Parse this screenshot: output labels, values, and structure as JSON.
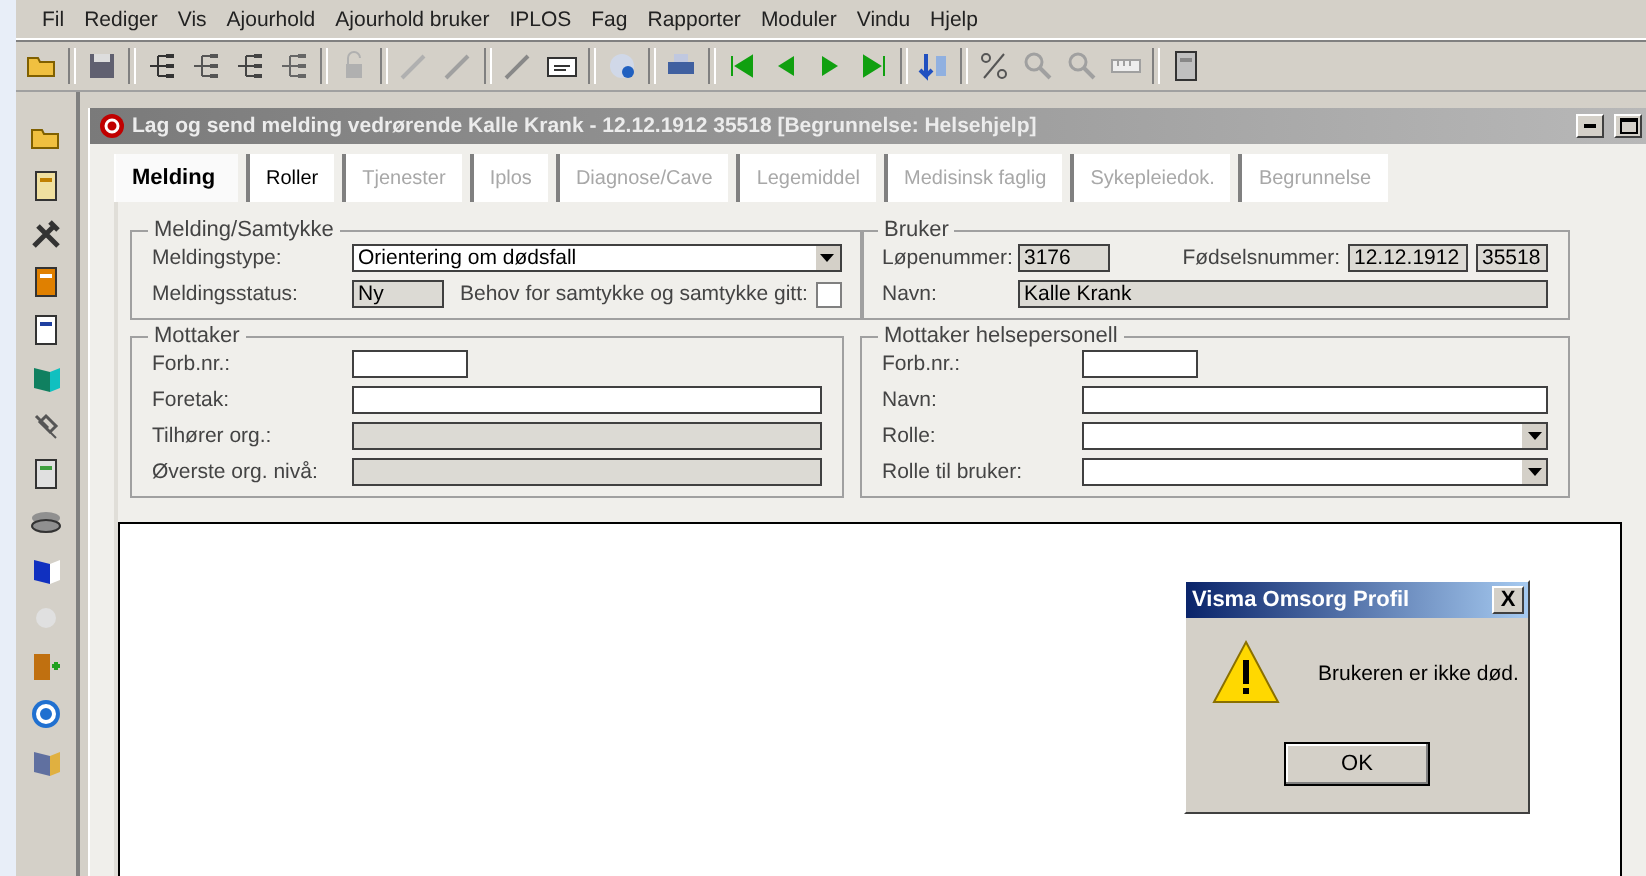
{
  "menu": [
    "Fil",
    "Rediger",
    "Vis",
    "Ajourhold",
    "Ajourhold bruker",
    "IPLOS",
    "Fag",
    "Rapporter",
    "Moduler",
    "Vindu",
    "Hjelp"
  ],
  "window": {
    "title": "Lag og send melding vedrørende Kalle Krank  -  12.12.1912  35518  [Begrunnelse: Helsehjelp]"
  },
  "tabs": [
    {
      "label": "Melding",
      "selected": true,
      "disabled": false
    },
    {
      "label": "Roller",
      "selected": false,
      "disabled": false
    },
    {
      "label": "Tjenester",
      "selected": false,
      "disabled": true
    },
    {
      "label": "Iplos",
      "selected": false,
      "disabled": true
    },
    {
      "label": "Diagnose/Cave",
      "selected": false,
      "disabled": true
    },
    {
      "label": "Legemiddel",
      "selected": false,
      "disabled": true
    },
    {
      "label": "Medisinsk faglig",
      "selected": false,
      "disabled": true
    },
    {
      "label": "Sykepleiedok.",
      "selected": false,
      "disabled": true
    },
    {
      "label": "Begrunnelse",
      "selected": false,
      "disabled": true
    }
  ],
  "melding_samtykke": {
    "title": "Melding/Samtykke",
    "meldingstype_label": "Meldingstype:",
    "meldingstype": "Orientering om dødsfall",
    "status_label": "Meldingsstatus:",
    "status": "Ny",
    "consent_label": "Behov for samtykke og samtykke gitt:",
    "consent_checked": false
  },
  "bruker": {
    "title": "Bruker",
    "lopenummer_label": "Løpenummer:",
    "lopenummer": "3176",
    "fodsel_label": "Fødselsnummer:",
    "fodselsdato": "12.12.1912",
    "personnummer": "35518",
    "navn_label": "Navn:",
    "navn": "Kalle Krank"
  },
  "mottaker": {
    "title": "Mottaker",
    "fields": [
      {
        "label": "Forb.nr.:",
        "kind": "short",
        "disabled": false
      },
      {
        "label": "Foretak:",
        "kind": "text",
        "disabled": false
      },
      {
        "label": "Tilhører org.:",
        "kind": "text",
        "disabled": true
      },
      {
        "label": "Øverste org. nivå:",
        "kind": "text",
        "disabled": true
      }
    ]
  },
  "mottaker_helsepersonell": {
    "title": "Mottaker helsepersonell",
    "fields": [
      {
        "label": "Forb.nr.:",
        "kind": "short",
        "disabled": false
      },
      {
        "label": "Navn:",
        "kind": "text",
        "disabled": false
      },
      {
        "label": "Rolle:",
        "kind": "dropdown",
        "disabled": false
      },
      {
        "label": "Rolle til bruker:",
        "kind": "dropdown",
        "disabled": false
      }
    ]
  },
  "dialog": {
    "title": "Visma Omsorg Profil",
    "close": "X",
    "message": "Brukeren er ikke død.",
    "button": "OK"
  }
}
